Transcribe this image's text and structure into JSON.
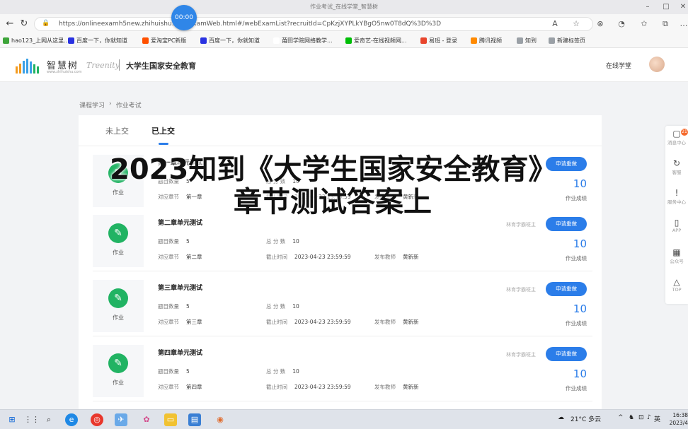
{
  "window": {
    "title": "作业考试_在线学堂_智慧树"
  },
  "browser": {
    "url": "https://onlineexamh5new.zhihuishu.co... cxamWeb.html#/webExamList?recruitId=CpKzjXYPLkYBgO5nw0T8dQ%3D%3D",
    "timer": "00:00"
  },
  "bookmarks": [
    {
      "label": "hao123_上网从这里...",
      "color": "#3ea53a"
    },
    {
      "label": "百度一下，你就知道",
      "color": "#2932e1"
    },
    {
      "label": "爱淘宝PC新版",
      "color": "#ff5000"
    },
    {
      "label": "百度一下，你就知道",
      "color": "#2932e1"
    },
    {
      "label": "莆田学院网络教学...",
      "color": "#ffffff"
    },
    {
      "label": "爱奇艺-在线视频网...",
      "color": "#00be06"
    },
    {
      "label": "易班 - 登录",
      "color": "#e8452c"
    },
    {
      "label": "腾讯视频",
      "color": "#ff8a00"
    },
    {
      "label": "知到",
      "color": "#9aa0a6"
    },
    {
      "label": "新建标签页",
      "color": "#9aa0a6"
    }
  ],
  "header": {
    "logo_text": "智慧树",
    "logo_sub": "www.zhihuishu.com",
    "partner": "Treenity",
    "course": "大学生国家安全教育",
    "online_school": "在线学堂"
  },
  "breadcrumb": [
    "课程学习",
    "作业考试"
  ],
  "tabs": [
    {
      "label": "未上交"
    },
    {
      "label": "已上交"
    }
  ],
  "overlay": {
    "line1": "2023知到《大学生国家安全教育》",
    "line2": "章节测试答案上"
  },
  "labels": {
    "type": "作业",
    "question_count": "题目数量",
    "chapter": "对应章节",
    "total_score": "总 分 数",
    "deadline": "截止时间",
    "publisher": "发布教师",
    "apply": "申请重做",
    "score_label": "作业成绩"
  },
  "cards": [
    {
      "title": "第一章单元测试",
      "questions": "5",
      "chapter": "第一章",
      "total": "10",
      "deadline": "2023-04-23 23:59:59",
      "teacher": "黄新新",
      "assistant": "",
      "score": "10"
    },
    {
      "title": "第二章单元测试",
      "questions": "5",
      "chapter": "第二章",
      "total": "10",
      "deadline": "2023-04-23 23:59:59",
      "teacher": "黄新新",
      "assistant": "林育学霸班主",
      "score": "10"
    },
    {
      "title": "第三章单元测试",
      "questions": "5",
      "chapter": "第三章",
      "total": "10",
      "deadline": "2023-04-23 23:59:59",
      "teacher": "黄新新",
      "assistant": "林育学霸班主",
      "score": "10"
    },
    {
      "title": "第四章单元测试",
      "questions": "5",
      "chapter": "第四章",
      "total": "10",
      "deadline": "2023-04-23 23:59:59",
      "teacher": "黄新新",
      "assistant": "林育学霸班主",
      "score": "10"
    }
  ],
  "sidetools": [
    {
      "icon": "message-icon",
      "glyph": "▢",
      "label": "消息中心",
      "badge": "21"
    },
    {
      "icon": "refresh-icon",
      "glyph": "↻",
      "label": "客服"
    },
    {
      "icon": "service-icon",
      "glyph": "!",
      "label": "服务中心"
    },
    {
      "icon": "phone-icon",
      "glyph": "▯",
      "label": "APP"
    },
    {
      "icon": "qrcode-icon",
      "glyph": "▦",
      "label": "公众号"
    },
    {
      "icon": "top-icon",
      "glyph": "△",
      "label": "TOP"
    }
  ],
  "taskbar": {
    "weather": "21°C 多云",
    "ime": "英",
    "time": "16:38",
    "date": "2023/4"
  }
}
